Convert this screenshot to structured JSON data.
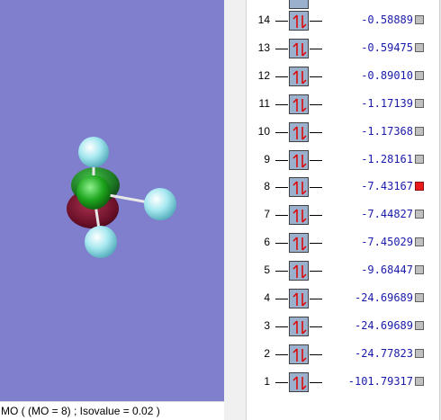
{
  "status_bar": {
    "text": "MO ( (MO = 8) ; Isovalue = 0.02 )"
  },
  "colors": {
    "viewport_background": "#7f7fcd",
    "energy_text": "#1a1aaa",
    "selected_orbital": "#e81a1a",
    "orbital_checkbox": "#c0c0c0",
    "electron_arrow": "#e00000",
    "occupied_box": "#9ab0cc",
    "central_atom": "#1ea61e",
    "hydrogen_atom": "#a6e8f0",
    "lobe_positive": "#1d8a1d",
    "lobe_negative": "#7a1530"
  },
  "orbitals": [
    {
      "index": "14",
      "energy": "-0.58889",
      "selected": false,
      "occupancy_icon": "spin-pair-arrows-icon"
    },
    {
      "index": "13",
      "energy": "-0.59475",
      "selected": false,
      "occupancy_icon": "spin-pair-arrows-icon"
    },
    {
      "index": "12",
      "energy": "-0.89010",
      "selected": false,
      "occupancy_icon": "spin-pair-arrows-icon"
    },
    {
      "index": "11",
      "energy": "-1.17139",
      "selected": false,
      "occupancy_icon": "spin-pair-arrows-icon"
    },
    {
      "index": "10",
      "energy": "-1.17368",
      "selected": false,
      "occupancy_icon": "spin-pair-arrows-icon"
    },
    {
      "index": "9",
      "energy": "-1.28161",
      "selected": false,
      "occupancy_icon": "spin-pair-arrows-icon"
    },
    {
      "index": "8",
      "energy": "-7.43167",
      "selected": true,
      "occupancy_icon": "spin-pair-arrows-icon"
    },
    {
      "index": "7",
      "energy": "-7.44827",
      "selected": false,
      "occupancy_icon": "spin-pair-arrows-icon"
    },
    {
      "index": "6",
      "energy": "-7.45029",
      "selected": false,
      "occupancy_icon": "spin-pair-arrows-icon"
    },
    {
      "index": "5",
      "energy": "-9.68447",
      "selected": false,
      "occupancy_icon": "spin-pair-arrows-icon"
    },
    {
      "index": "4",
      "energy": "-24.69689",
      "selected": false,
      "occupancy_icon": "spin-pair-arrows-icon"
    },
    {
      "index": "3",
      "energy": "-24.69689",
      "selected": false,
      "occupancy_icon": "spin-pair-arrows-icon"
    },
    {
      "index": "2",
      "energy": "-24.77823",
      "selected": false,
      "occupancy_icon": "spin-pair-arrows-icon"
    },
    {
      "index": "1",
      "energy": "-101.79317",
      "selected": false,
      "occupancy_icon": "spin-pair-arrows-icon"
    }
  ]
}
